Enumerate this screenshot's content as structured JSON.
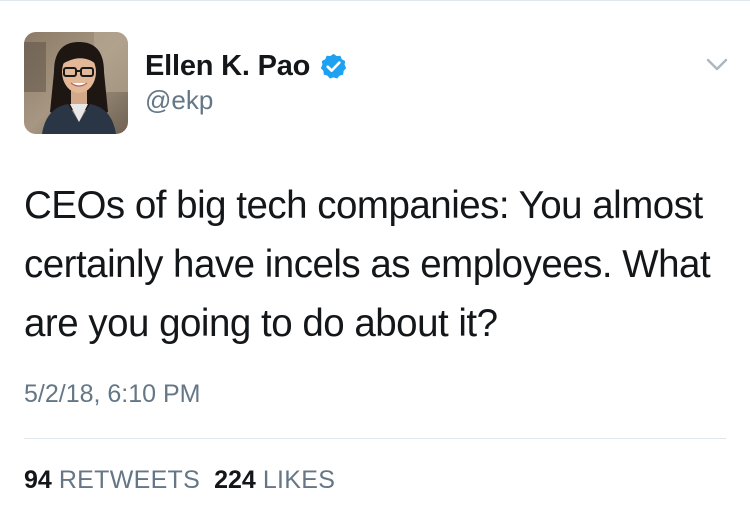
{
  "author": {
    "display_name": "Ellen K. Pao",
    "handle": "@ekp",
    "verified": true
  },
  "tweet": {
    "text": "CEOs of big tech companies: You almost certainly have incels as employees. What are you going to do about it?",
    "timestamp": "5/2/18, 6:10 PM"
  },
  "stats": {
    "retweets_count": "94",
    "retweets_label": "RETWEETS",
    "likes_count": "224",
    "likes_label": "LIKES"
  },
  "icons": {
    "verified": "verified-badge-icon",
    "menu": "chevron-down-icon"
  },
  "colors": {
    "text_primary": "#14171a",
    "text_secondary": "#657786",
    "verified_blue": "#1da1f2",
    "divider": "#e1e8ed"
  }
}
